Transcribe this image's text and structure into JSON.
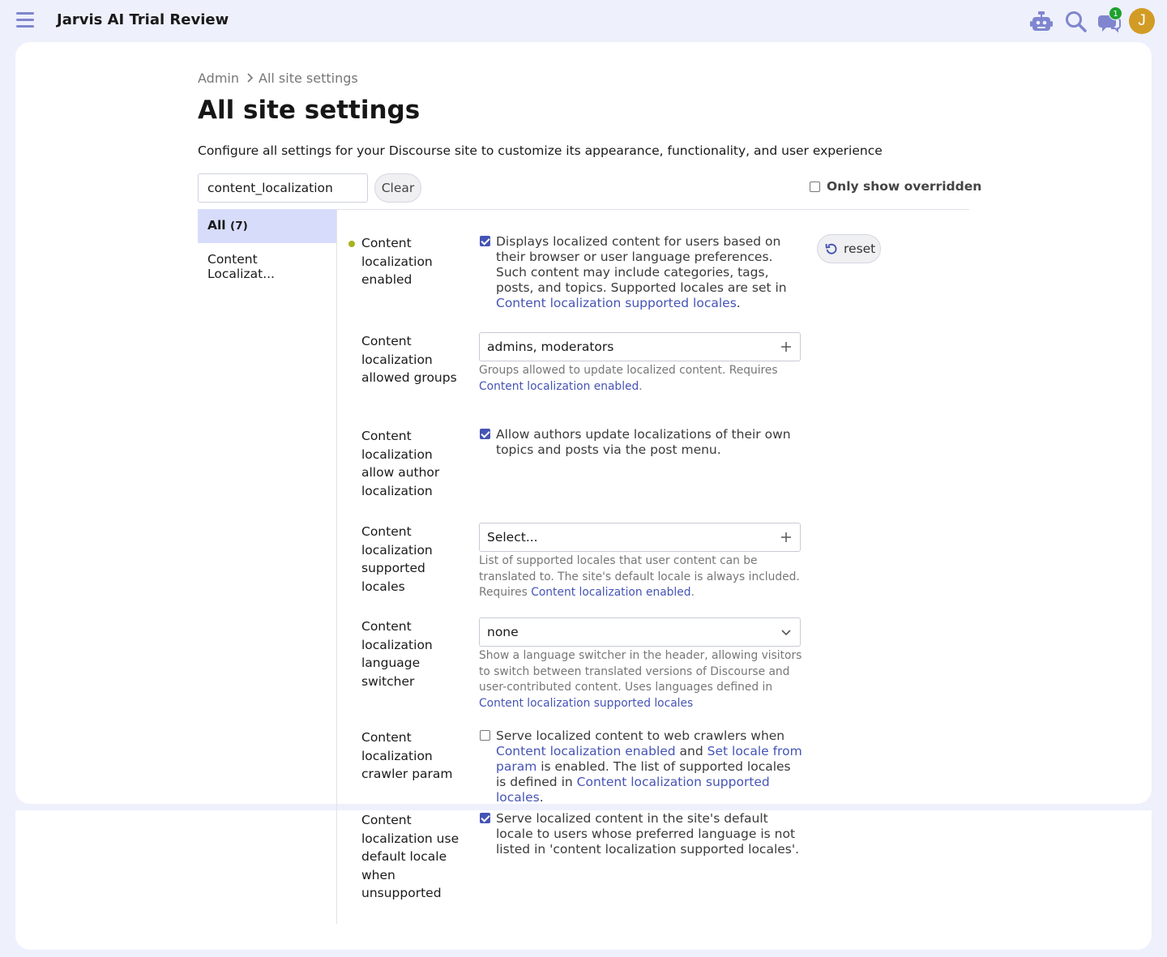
{
  "header": {
    "site_title": "Jarvis AI Trial Review",
    "chat_badge": "1",
    "avatar_letter": "J",
    "icons": [
      "hamburger-icon",
      "robot-icon",
      "search-icon",
      "chat-icon"
    ]
  },
  "breadcrumb": {
    "root": "Admin",
    "current": "All site settings"
  },
  "page": {
    "title": "All site settings",
    "description": "Configure all settings for your Discourse site to customize its appearance, functionality, and user experience"
  },
  "filter": {
    "value": "content_localization",
    "clear_label": "Clear",
    "only_overridden_label": "Only show overridden",
    "only_overridden_checked": false
  },
  "categories": [
    {
      "label": "All",
      "count": "(7)",
      "active": true
    },
    {
      "label": "Content Localizat...",
      "active": false
    }
  ],
  "settings": {
    "enabled": {
      "label": "Content localization enabled",
      "checked": true,
      "text_before": "Displays localized content for users based on their browser or user language preferences. Such content may include categories, tags, posts, and topics. Supported locales are set in ",
      "link": "Content localization supported locales",
      "text_after": ".",
      "reset_label": "reset"
    },
    "allowed_groups": {
      "label": "Content localization allowed groups",
      "value": "admins, moderators",
      "help_before": "Groups allowed to update localized content. Requires ",
      "help_link": "Content localization enabled",
      "help_after": "."
    },
    "author": {
      "label": "Content localization allow author localization",
      "checked": true,
      "text": "Allow authors update localizations of their own topics and posts via the post menu."
    },
    "supported_locales": {
      "label": "Content localization supported locales",
      "value": "Select...",
      "help_before": "List of supported locales that user content can be translated to. The site's default locale is always included. Requires ",
      "help_link": "Content localization enabled",
      "help_after": "."
    },
    "switcher": {
      "label": "Content localization language switcher",
      "value": "none",
      "help_before": "Show a language switcher in the header, allowing visitors to switch between translated versions of Discourse and user-contributed content. Uses languages defined in ",
      "help_link": "Content localization supported locales"
    },
    "crawler": {
      "label": "Content localization crawler param",
      "checked": false,
      "t1": "Serve localized content to web crawlers when ",
      "l1": "Content localization enabled",
      "t2": " and ",
      "l2": "Set locale from param",
      "t3": " is enabled. The list of supported locales is defined in ",
      "l3": "Content localization supported locales",
      "t4": "."
    },
    "default_locale": {
      "label": "Content localization use default locale when unsupported",
      "checked": true,
      "text": "Serve localized content in the site's default locale to users whose preferred language is not listed in 'content localization supported locales'."
    }
  },
  "colors": {
    "accent": "#4554b5",
    "active_category": "#d8dcfb",
    "override_dot": "#a9b31e",
    "badge": "#1ea12e",
    "avatar": "#d29b24"
  }
}
